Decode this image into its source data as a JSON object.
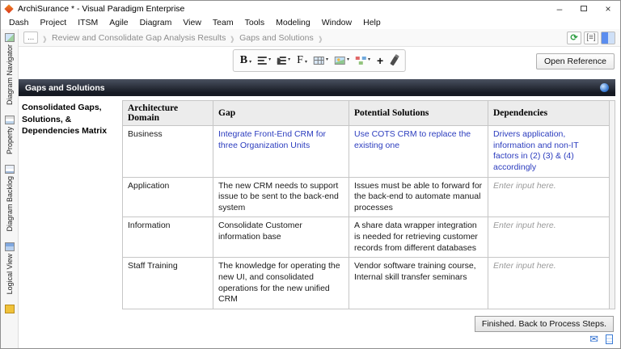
{
  "window": {
    "title": "ArchiSurance * - Visual Paradigm Enterprise"
  },
  "menu": {
    "items": [
      "Dash",
      "Project",
      "ITSM",
      "Agile",
      "Diagram",
      "View",
      "Team",
      "Tools",
      "Modeling",
      "Window",
      "Help"
    ]
  },
  "breadcrumb": {
    "ellipsis": "...",
    "items": [
      "Review and Consolidate Gap Analysis Results",
      "Gaps and Solutions"
    ]
  },
  "sidebar": {
    "tabs": [
      "Diagram Navigator",
      "Property",
      "Diagram Backlog",
      "Logical View"
    ]
  },
  "toolbar": {
    "open_reference": "Open Reference"
  },
  "panel": {
    "title": "Gaps and Solutions"
  },
  "matrix": {
    "label": "Consolidated Gaps, Solutions, & Dependencies Matrix",
    "headers": [
      "Architecture Domain",
      "Gap",
      "Potential Solutions",
      "Dependencies"
    ],
    "rows": [
      {
        "domain": "Business",
        "gap": "Integrate Front-End CRM for three Organization Units",
        "solution": "Use COTS CRM to replace the existing one",
        "dependency": "Drivers application, information and non-IT factors in (2) (3) & (4) accordingly"
      },
      {
        "domain": "Application",
        "gap": "The new CRM needs to support issue to be sent to the back-end system",
        "solution": "Issues must be able to forward for the back-end to automate manual processes",
        "dependency": "Enter input here."
      },
      {
        "domain": "Information",
        "gap": "Consolidate Customer information base",
        "solution": "A share data wrapper integration is needed for retrieving customer records from different databases",
        "dependency": "Enter input here."
      },
      {
        "domain": "Staff Training",
        "gap": "The knowledge for operating the new UI, and consolidated operations for the new unified CRM",
        "solution": "Vendor software training course, Internal skill transfer seminars",
        "dependency": "Enter input here."
      }
    ]
  },
  "footer": {
    "finished_button": "Finished. Back to Process Steps."
  },
  "icons": {
    "minimize": "–",
    "close": "×",
    "caret": "▾",
    "chevron": "›",
    "bold_glyph": "B",
    "font_glyph": "F",
    "plus_glyph": "+",
    "sync": "⟳",
    "brackets": "[≡]",
    "mail": "✉"
  },
  "colors": {
    "entry_text": "#2b3cbe",
    "placeholder_text": "#9a9a9a",
    "panel_bar": "#161a23",
    "logo_red": "#d8341c"
  }
}
